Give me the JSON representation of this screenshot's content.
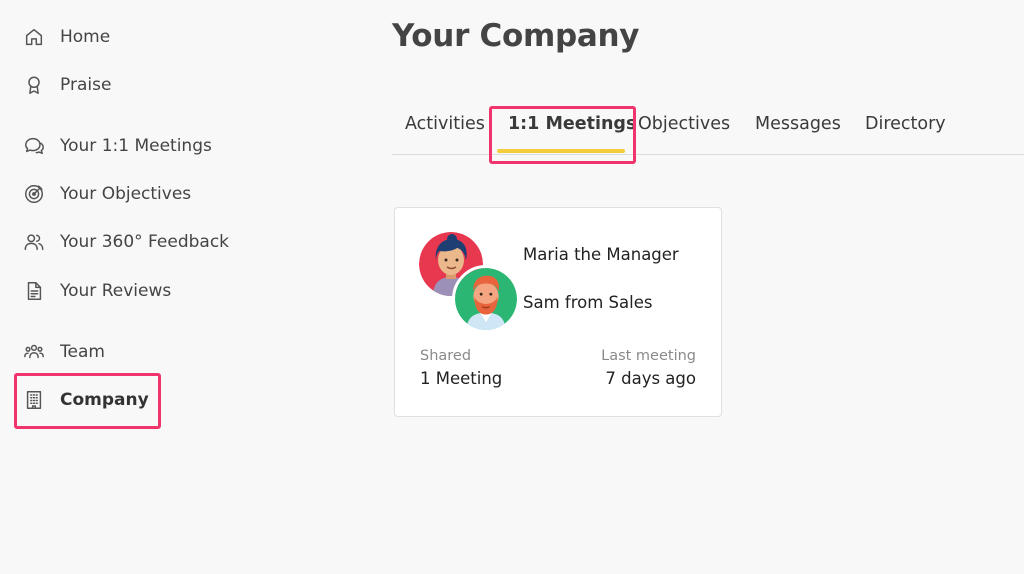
{
  "sidebar": {
    "items": [
      {
        "label": "Home",
        "icon": "home-icon"
      },
      {
        "label": "Praise",
        "icon": "award-icon"
      },
      {
        "label": "Your 1:1 Meetings",
        "icon": "chat-bubbles-icon"
      },
      {
        "label": "Your Objectives",
        "icon": "target-icon"
      },
      {
        "label": "Your 360° Feedback",
        "icon": "users-icon"
      },
      {
        "label": "Your Reviews",
        "icon": "document-icon"
      },
      {
        "label": "Team",
        "icon": "team-icon"
      },
      {
        "label": "Company",
        "icon": "building-icon",
        "active": true
      }
    ]
  },
  "header": {
    "title": "Your Company"
  },
  "tabs": [
    {
      "label": "Activities"
    },
    {
      "label": "1:1 Meetings",
      "active": true
    },
    {
      "label": "Objectives"
    },
    {
      "label": "Messages"
    },
    {
      "label": "Directory"
    }
  ],
  "meeting_card": {
    "participants": [
      "Maria the Manager",
      "Sam from Sales"
    ],
    "shared_label": "Shared",
    "shared_value": "1 Meeting",
    "last_label": "Last meeting",
    "last_value": "7 days ago"
  },
  "colors": {
    "highlight": "#f0346c",
    "tab_underline": "#f2cc3a",
    "avatar_maria_bg": "#e8384f",
    "avatar_sam_bg": "#2bb673"
  }
}
